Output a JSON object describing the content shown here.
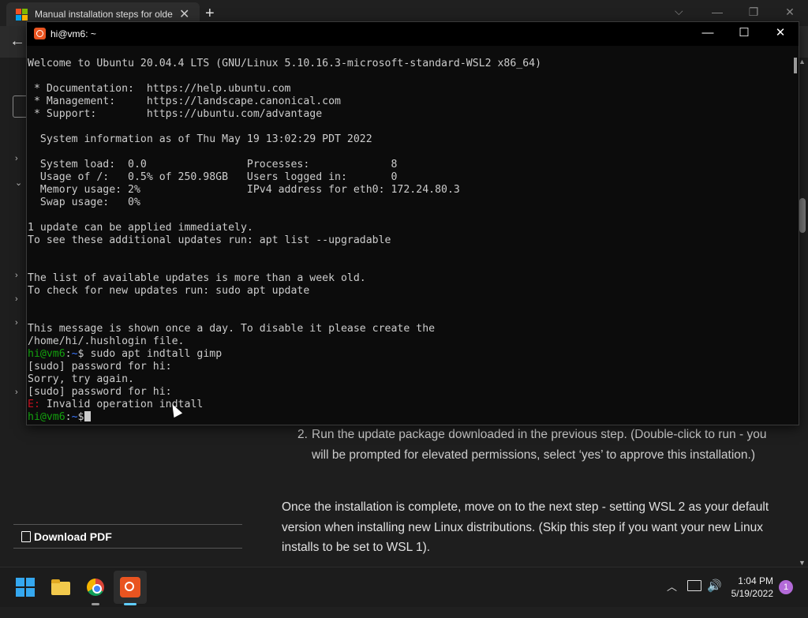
{
  "browser": {
    "tab_title": "Manual installation steps for older versions of WSL",
    "tab_close": "✕",
    "new_tab": "+",
    "back": "←",
    "chevron": "⌵",
    "minimize": "—",
    "maximize": "❐",
    "close": "✕"
  },
  "page": {
    "left_chevrons": [
      "›",
      "⌄",
      "›",
      "›",
      "›",
      "›"
    ],
    "download_pdf": "Download PDF",
    "step_number": "2.",
    "step_text": "Run the update package downloaded in the previous step. (Double-click to run - you will be prompted for elevated permissions, select ‘yes’ to approve this installation.)",
    "paragraph": "Once the installation is complete, move on to the next step - setting WSL 2 as your default version when installing new Linux distributions. (Skip this step if you want your new Linux installs to be set to WSL 1)."
  },
  "terminal": {
    "title": "hi@vm6: ~",
    "minimize": "—",
    "maximize": "☐",
    "close": "✕",
    "lines": [
      "Welcome to Ubuntu 20.04.4 LTS (GNU/Linux 5.10.16.3-microsoft-standard-WSL2 x86_64)",
      "",
      " * Documentation:  https://help.ubuntu.com",
      " * Management:     https://landscape.canonical.com",
      " * Support:        https://ubuntu.com/advantage",
      "",
      "  System information as of Thu May 19 13:02:29 PDT 2022",
      "",
      "  System load:  0.0                Processes:             8",
      "  Usage of /:   0.5% of 250.98GB   Users logged in:       0",
      "  Memory usage: 2%                 IPv4 address for eth0: 172.24.80.3",
      "  Swap usage:   0%",
      "",
      "1 update can be applied immediately.",
      "To see these additional updates run: apt list --upgradable",
      "",
      "",
      "The list of available updates is more than a week old.",
      "To check for new updates run: sudo apt update",
      "",
      "",
      "This message is shown once a day. To disable it please create the",
      "/home/hi/.hushlogin file."
    ],
    "prompt_user": "hi@vm6",
    "prompt_sep": ":",
    "prompt_path": "~",
    "prompt_dollar": "$",
    "command1": " sudo apt indtall gimp",
    "sudo_prompt1": "[sudo] password for hi:",
    "sorry": "Sorry, try again.",
    "sudo_prompt2": "[sudo] password for hi:",
    "error_prefix": "E:",
    "error_text": " Invalid operation indtall",
    "prompt2_user": "hi@vm6",
    "prompt2_sep": ":",
    "prompt2_path": "~",
    "prompt2_dollar": "$"
  },
  "taskbar": {
    "tray_chevron": "︿",
    "volume": "🔊",
    "time": "1:04 PM",
    "date": "5/19/2022",
    "notifications": "1"
  },
  "colors": {
    "ms_red": "#f25022",
    "ms_green": "#7fba00",
    "ms_blue": "#00a4ef",
    "ms_yellow": "#ffb900",
    "ubuntu_orange": "#e95420",
    "prompt_green": "#13a10e",
    "path_blue": "#3b78ff",
    "error_red": "#c50f1f"
  }
}
